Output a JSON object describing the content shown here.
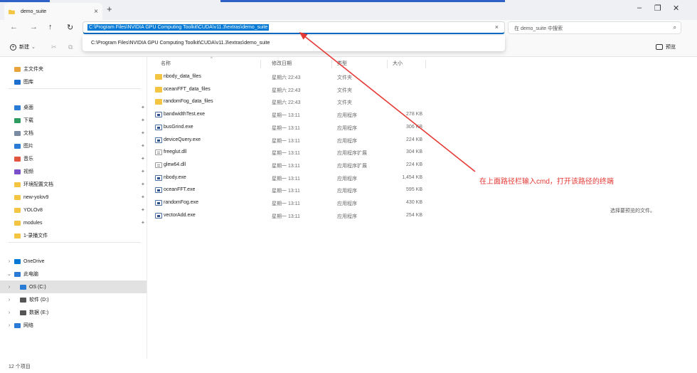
{
  "window": {
    "tab_title": "demo_suite",
    "tab_close": "×",
    "new_tab": "+",
    "minimize": "–",
    "maximize": "❐",
    "close": "✕"
  },
  "nav": {
    "back": "←",
    "forward": "→",
    "up": "↑",
    "refresh": "↻",
    "address": "C:\\Program Files\\NVIDIA GPU Computing Toolkit\\CUDA\\v11.3\\extras\\demo_suite",
    "address_clear": "×",
    "suggestion": "C:\\Program Files\\NVIDIA GPU Computing Toolkit\\CUDA\\v11.3\\extras\\demo_suite",
    "search_placeholder": "在 demo_suite 中搜索",
    "search_icon": "⌕"
  },
  "toolbar": {
    "new_label": "新建",
    "new_chevron": "⌄",
    "cut_icon": "✂",
    "copy_icon": "⧉",
    "preview_label": "预览"
  },
  "sidebar": {
    "items": [
      {
        "label": "主文件夹",
        "icon": "home-icon",
        "color": "#e8a33c"
      },
      {
        "label": "图库",
        "icon": "gallery-icon",
        "color": "#1f6fd1"
      },
      {
        "label": "桌面",
        "icon": "desktop-icon",
        "color": "#2a7bd6",
        "pin": "✦"
      },
      {
        "label": "下载",
        "icon": "download-icon",
        "color": "#2d9c5e",
        "pin": "✦"
      },
      {
        "label": "文档",
        "icon": "document-icon",
        "color": "#7a8aa0",
        "pin": "✦"
      },
      {
        "label": "图片",
        "icon": "pictures-icon",
        "color": "#2a7bd6",
        "pin": "✦"
      },
      {
        "label": "音乐",
        "icon": "music-icon",
        "color": "#e2553f",
        "pin": "✦"
      },
      {
        "label": "视频",
        "icon": "video-icon",
        "color": "#7b4fc9",
        "pin": "✦"
      },
      {
        "label": "环境配置文档",
        "icon": "folder-icon",
        "color": "#f4c542",
        "pin": "✦"
      },
      {
        "label": "new-yolov9",
        "icon": "folder-icon",
        "color": "#f4c542",
        "pin": "✦"
      },
      {
        "label": "YOLOv8",
        "icon": "folder-icon",
        "color": "#f4c542",
        "pin": "✦"
      },
      {
        "label": "modules",
        "icon": "folder-icon",
        "color": "#f4c542",
        "pin": "✦"
      },
      {
        "label": "1-录播文件",
        "icon": "folder-icon",
        "color": "#f4c542"
      },
      {
        "label": "OneDrive",
        "icon": "onedrive-icon",
        "color": "#0078d4",
        "chevron": "›"
      },
      {
        "label": "此电脑",
        "icon": "pc-icon",
        "color": "#2a7bd6",
        "chevron": "⌄"
      },
      {
        "label": "OS (C:)",
        "icon": "drive-icon",
        "color": "#2a7bd6",
        "chevron": "›"
      },
      {
        "label": "软件 (D:)",
        "icon": "drive-icon",
        "color": "#555555",
        "chevron": "›"
      },
      {
        "label": "数据 (E:)",
        "icon": "drive-icon",
        "color": "#555555",
        "chevron": "›"
      },
      {
        "label": "网络",
        "icon": "network-icon",
        "color": "#2a7bd6",
        "chevron": "›"
      }
    ]
  },
  "columns": {
    "name": "名称",
    "date": "修改日期",
    "type": "类型",
    "size": "大小",
    "sort_caret": "^"
  },
  "files": [
    {
      "name": "nbody_data_files",
      "date": "星期六 22:43",
      "type": "文件夹",
      "size": "",
      "kind": "folder"
    },
    {
      "name": "oceanFFT_data_files",
      "date": "星期六 22:43",
      "type": "文件夹",
      "size": "",
      "kind": "folder"
    },
    {
      "name": "randomFog_data_files",
      "date": "星期六 22:43",
      "type": "文件夹",
      "size": "",
      "kind": "folder"
    },
    {
      "name": "bandwidthTest.exe",
      "date": "星期一 13:11",
      "type": "应用程序",
      "size": "278 KB",
      "kind": "exe"
    },
    {
      "name": "busGrind.exe",
      "date": "星期一 13:11",
      "type": "应用程序",
      "size": "306 KB",
      "kind": "exe"
    },
    {
      "name": "deviceQuery.exe",
      "date": "星期一 13:11",
      "type": "应用程序",
      "size": "224 KB",
      "kind": "exe"
    },
    {
      "name": "freeglut.dll",
      "date": "星期一 13:11",
      "type": "应用程序扩展",
      "size": "304 KB",
      "kind": "dll"
    },
    {
      "name": "glew64.dll",
      "date": "星期一 13:11",
      "type": "应用程序扩展",
      "size": "224 KB",
      "kind": "dll"
    },
    {
      "name": "nbody.exe",
      "date": "星期一 13:11",
      "type": "应用程序",
      "size": "1,454 KB",
      "kind": "exe"
    },
    {
      "name": "oceanFFT.exe",
      "date": "星期一 13:11",
      "type": "应用程序",
      "size": "595 KB",
      "kind": "exe"
    },
    {
      "name": "randomFog.exe",
      "date": "星期一 13:11",
      "type": "应用程序",
      "size": "430 KB",
      "kind": "exe"
    },
    {
      "name": "vectorAdd.exe",
      "date": "星期一 13:11",
      "type": "应用程序",
      "size": "254 KB",
      "kind": "exe"
    }
  ],
  "annotation": "在上面路径栏输入cmd，打开该路径的终端",
  "annotation_color": "#e53935",
  "preview_message": "选择要预览的文件。",
  "status": "12 个项目",
  "accent_color": "#0078d4"
}
